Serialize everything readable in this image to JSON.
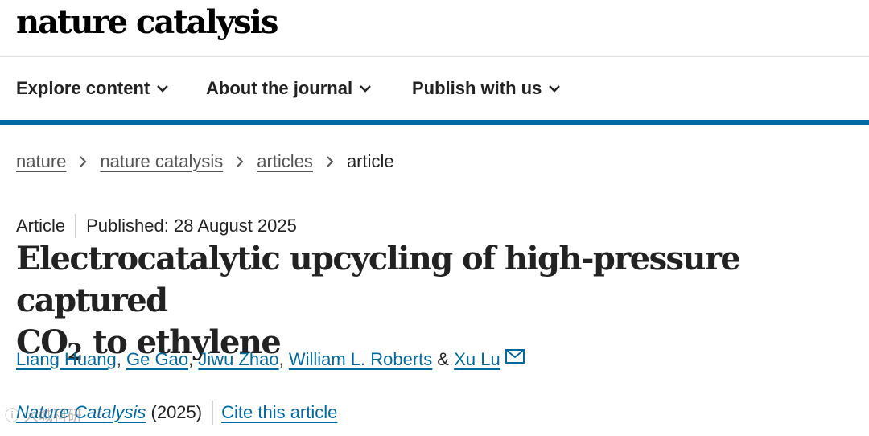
{
  "site": {
    "logo_text": "nature catalysis"
  },
  "nav": {
    "items": [
      {
        "label": "Explore content",
        "icon": "chevron-down-icon"
      },
      {
        "label": "About the journal",
        "icon": "chevron-down-icon"
      },
      {
        "label": "Publish with us",
        "icon": "chevron-down-icon"
      }
    ]
  },
  "breadcrumb": {
    "items": [
      "nature",
      "nature catalysis",
      "articles"
    ],
    "current": "article"
  },
  "article": {
    "type": "Article",
    "published": "Published: 28 August 2025",
    "title_line1": "Electrocatalytic upcycling of high-pressure captured",
    "title_line2_a": "CO",
    "title_line2_sub": "2",
    "title_line2_b": " to ethylene",
    "authors": [
      "Liang Huang",
      "Ge Gao",
      "Jiwu Zhao",
      "William L. Roberts",
      "Xu Lu"
    ],
    "author_sep": ", ",
    "author_and": " & ",
    "journal_name": "Nature Catalysis",
    "year": " (2025)",
    "cite_label": "Cite this article"
  },
  "watermark": {
    "text": "ⓘ 大城科研"
  },
  "colors": {
    "brand_blue": "#0069a0",
    "text": "#222222",
    "muted": "#555555"
  }
}
